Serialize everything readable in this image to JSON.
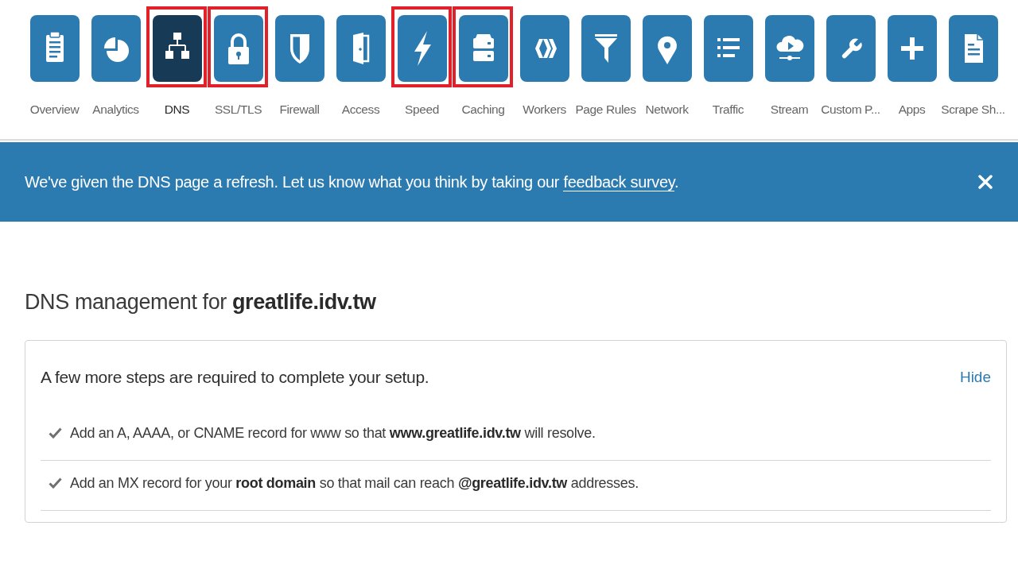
{
  "nav": {
    "items": [
      {
        "label": "Overview",
        "selected": false,
        "highlighted": false
      },
      {
        "label": "Analytics",
        "selected": false,
        "highlighted": false
      },
      {
        "label": "DNS",
        "selected": true,
        "highlighted": true
      },
      {
        "label": "SSL/TLS",
        "selected": false,
        "highlighted": true
      },
      {
        "label": "Firewall",
        "selected": false,
        "highlighted": false
      },
      {
        "label": "Access",
        "selected": false,
        "highlighted": false
      },
      {
        "label": "Speed",
        "selected": false,
        "highlighted": true
      },
      {
        "label": "Caching",
        "selected": false,
        "highlighted": true
      },
      {
        "label": "Workers",
        "selected": false,
        "highlighted": false
      },
      {
        "label": "Page Rules",
        "selected": false,
        "highlighted": false
      },
      {
        "label": "Network",
        "selected": false,
        "highlighted": false
      },
      {
        "label": "Traffic",
        "selected": false,
        "highlighted": false
      },
      {
        "label": "Stream",
        "selected": false,
        "highlighted": false
      },
      {
        "label": "Custom P...",
        "selected": false,
        "highlighted": false
      },
      {
        "label": "Apps",
        "selected": false,
        "highlighted": false
      },
      {
        "label": "Scrape Sh...",
        "selected": false,
        "highlighted": false
      }
    ]
  },
  "banner": {
    "message": "We've given the DNS page a refresh. Let us know what you think by taking our",
    "link": "feedback survey",
    "message_end": "."
  },
  "heading": "DNS management for **greatlife.idv.tw**",
  "setup_card": {
    "title": "A few more steps are required to complete your setup.",
    "hide_link": "Hide",
    "steps": [
      {
        "text": "Add an A, AAAA, or CNAME record for www so that **www.greatlife.idv.tw** will resolve.",
        "checked": true
      },
      {
        "text": "Add an MX record for your **root domain** so that mail can reach **@greatlife.idv.tw** addresses.",
        "checked": true
      }
    ]
  }
}
